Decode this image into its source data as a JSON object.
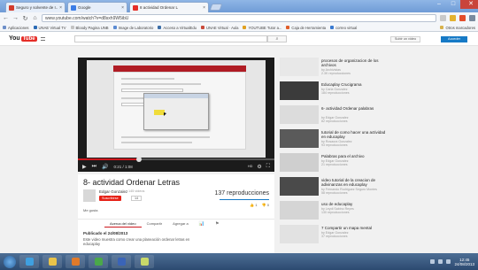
{
  "browser": {
    "tabs": [
      {
        "label": "Seguro y solvente de I...",
        "fav_color": "#d33b2c",
        "active": false
      },
      {
        "label": "Google",
        "fav_color": "#3c7de6",
        "active": false
      },
      {
        "label": "8 actividad Ordenar L",
        "fav_color": "#e52d27",
        "active": true
      }
    ],
    "window_controls": {
      "minimize": "–",
      "maximize": "□",
      "close": "✕"
    },
    "address": "www.youtube.com/watch?v=d8sxh9W5ibU",
    "nav": {
      "back": "←",
      "forward": "→",
      "reload": "↻",
      "home": "⌂"
    },
    "bookmarks": [
      {
        "label": "Aplicaciones",
        "color": "#6d8fc9"
      },
      {
        "label": "UNAE Virtual TV",
        "color": "#2a6bb5"
      },
      {
        "label": "Bloody Pagina UNB",
        "color": "#c3c3c3"
      },
      {
        "label": "Image de Laboratorio",
        "color": "#5b8bd2"
      },
      {
        "label": "Acceso a VirtualEdu",
        "color": "#3b6ea8"
      },
      {
        "label": "UNAE Virtual · Aula",
        "color": "#c94a3a"
      },
      {
        "label": "YOUTUBE Tutor a...",
        "color": "#e0a020"
      },
      {
        "label": "Caja de Herramienta",
        "color": "#e05e2a"
      },
      {
        "label": "correo virtual",
        "color": "#3a7ad0"
      },
      {
        "label": "Otros marcadores",
        "color": "#d8b24c"
      }
    ]
  },
  "youtube": {
    "logo_you": "You",
    "logo_tube": "Tube",
    "search_icon": "search-icon",
    "search_glyph": "⌕",
    "upload_label": "Subir un video",
    "signin_label": "Acceder",
    "player": {
      "progress_fraction": 0.31,
      "time": "0:21 / 1:08",
      "play": "▶",
      "next": "⏭",
      "volume": "🔊",
      "settings": "⚙",
      "fullscreen": "⛶",
      "hd": "HD"
    },
    "video": {
      "title": "8- actividad Ordenar Letras",
      "channel": "Edgar Gonzalez",
      "video_count": "145 videos",
      "subscribe_label": "Suscribirse",
      "subscriber_count": "14",
      "views": "137 reproducciones",
      "likes": "1",
      "dislikes": "0",
      "like_glyph": "👍",
      "dislike_glyph": "👎",
      "add_to": "Me gusta"
    },
    "tabs": [
      "Acerca del video",
      "Compartir",
      "Agregar a"
    ],
    "tab_icons": [
      "📊",
      "⚑"
    ],
    "description": {
      "published": "Publicado el 24/08/2013",
      "text": "Este video muestra como crear una planeación ordenar letras en educaplay"
    },
    "related": [
      {
        "title": "procesos de organizacion de los archivos",
        "channel": "by Archivistas",
        "views": "2.3K reproducciones",
        "thumb": "#e8e8e8"
      },
      {
        "title": "Educaplay Crucigrama",
        "channel": "by Carla Gonzalez",
        "views": "184 reproducciones",
        "thumb": "#3b3b3b"
      },
      {
        "title": "6- actividad Ordenar palabras",
        "channel": "by Edgar Gonzalez",
        "views": "82 reproducciones",
        "thumb": "#dcdcdc"
      },
      {
        "title": "tutorial de como hacer una actividad en educaplay",
        "channel": "by Rosaura Gonzalez",
        "views": "93 reproducciones",
        "thumb": "#5a5a5a"
      },
      {
        "title": "Palabras para el archivo",
        "channel": "by Edgar Gonzalez",
        "views": "21 reproducciones",
        "thumb": "#cfcfcf"
      },
      {
        "title": "video tutorial de la creacion de adivinanzas en educaplay",
        "channel": "by Fernando Rodriguez Seguro Montes",
        "views": "58 reproducciones",
        "thumb": "#4a4a4a"
      },
      {
        "title": "uso de educaplay",
        "channel": "by Leydi Sabino Reyes",
        "views": "130 reproducciones",
        "thumb": "#d5d5d5"
      },
      {
        "title": "7 Compartir un mapa mental",
        "channel": "by Edgar Gonzalez",
        "views": "37 reproducciones",
        "thumb": "#e2e2e2"
      }
    ]
  },
  "taskbar": {
    "apps": [
      {
        "name": "ie-icon",
        "color": "#3fa0e0"
      },
      {
        "name": "explorer-icon",
        "color": "#e8c34a"
      },
      {
        "name": "media-icon",
        "color": "#e07a2a"
      },
      {
        "name": "chrome-icon",
        "color": "#4aa84a"
      },
      {
        "name": "word-icon",
        "color": "#3a64b8"
      },
      {
        "name": "paint-icon",
        "color": "#c8d96a"
      }
    ],
    "clock_time": "12:45",
    "clock_date": "24/08/2013"
  }
}
